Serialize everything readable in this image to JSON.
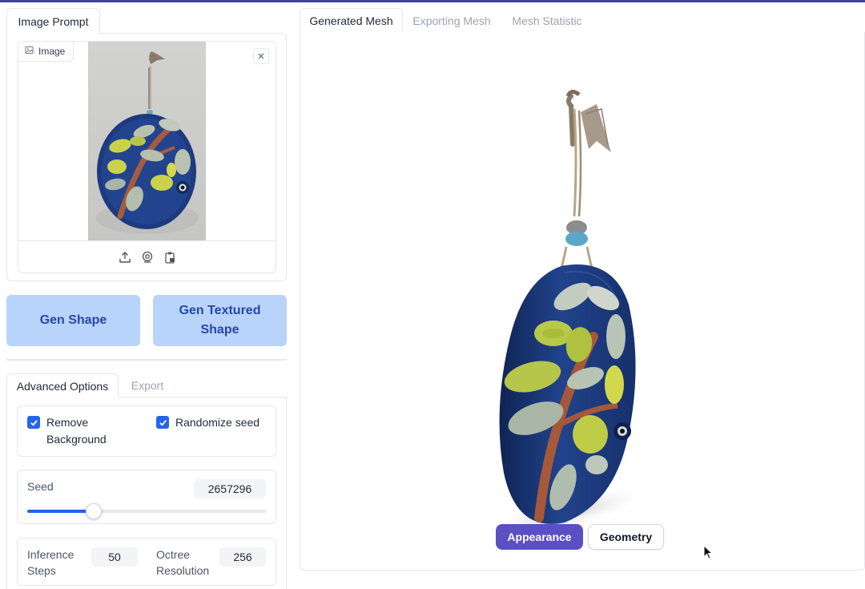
{
  "left": {
    "prompt_tab_label": "Image Prompt",
    "image_label": "Image",
    "gen_shape_label": "Gen Shape",
    "gen_textured_label": "Gen Textured Shape",
    "options_tabs": [
      "Advanced Options",
      "Export"
    ],
    "remove_background_label": "Remove Background",
    "remove_background_checked": true,
    "randomize_seed_label": "Randomize seed",
    "randomize_seed_checked": true,
    "seed_label": "Seed",
    "seed_value": "2657296",
    "seed_slider_fraction": 0.28,
    "inference_steps_label": "Inference Steps",
    "inference_steps_value": "50",
    "octree_resolution_label": "Octree Resolution",
    "octree_resolution_value": "256"
  },
  "right": {
    "tabs": [
      "Generated Mesh",
      "Exporting Mesh",
      "Mesh Statistic"
    ],
    "view_buttons": [
      "Appearance",
      "Geometry"
    ],
    "active_view": "Appearance"
  },
  "colors": {
    "accent_blue": "#2563eb",
    "button_light_blue": "#b9d4fb",
    "button_text_blue": "#2548a8",
    "appearance_purple": "#5b4fc4",
    "ornament_blue": "#1f3f86",
    "leaf_green": "#b9c94a"
  },
  "icons": [
    "image-icon",
    "close-icon",
    "upload-icon",
    "webcam-icon",
    "clipboard-icon",
    "checkmark-icon",
    "cursor-icon"
  ]
}
